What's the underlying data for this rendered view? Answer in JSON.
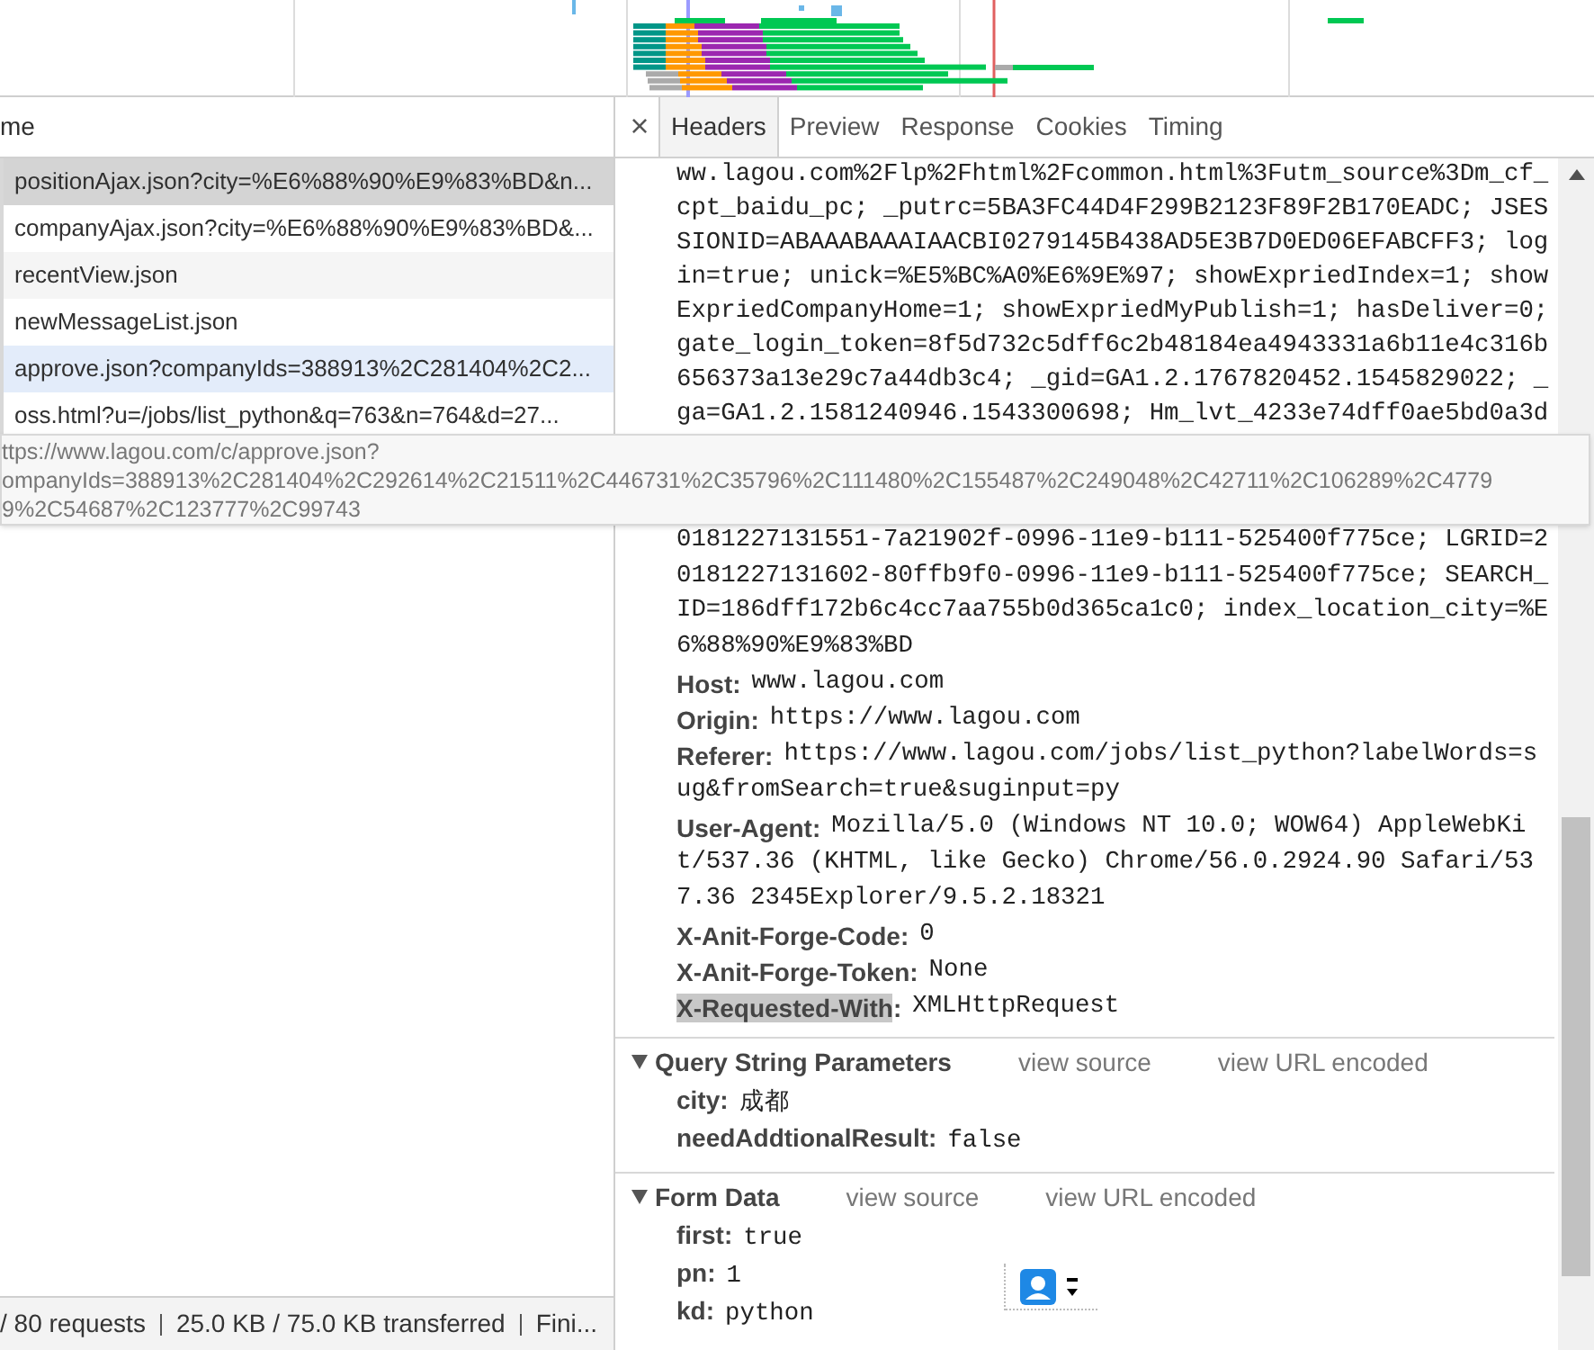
{
  "requests_panel": {
    "column_header": "me",
    "rows": [
      {
        "name": "positionAjax.json?city=%E6%88%90%E9%83%BD&n...",
        "selected": true,
        "hovered": false
      },
      {
        "name": "companyAjax.json?city=%E6%88%90%E9%83%BD&...",
        "selected": false,
        "hovered": false
      },
      {
        "name": "recentView.json",
        "selected": false,
        "hovered": false
      },
      {
        "name": "newMessageList.json",
        "selected": false,
        "hovered": false
      },
      {
        "name": "approve.json?companyIds=388913%2C281404%2C2...",
        "selected": false,
        "hovered": true
      },
      {
        "name": "oss.html?u=/jobs/list_python&q=763&n=764&d=27...",
        "selected": false,
        "hovered": false
      }
    ]
  },
  "status_bar": {
    "items": [
      "/ 80 requests",
      "25.0 KB / 75.0 KB transferred",
      "Fini..."
    ]
  },
  "tooltip": {
    "lines": [
      "ttps://www.lagou.com/c/approve.json?",
      "ompanyIds=388913%2C281404%2C292614%2C21511%2C446731%2C35796%2C111480%2C155487%2C249048%2C42711%2C106289%2C4779",
      "9%2C54687%2C123777%2C99743"
    ]
  },
  "details": {
    "close": "×",
    "tabs": [
      {
        "label": "Headers",
        "selected": true
      },
      {
        "label": "Preview",
        "selected": false
      },
      {
        "label": "Response",
        "selected": false
      },
      {
        "label": "Cookies",
        "selected": false
      },
      {
        "label": "Timing",
        "selected": false
      }
    ],
    "separator": ":",
    "cookie_lines_above": [
      "ww.lagou.com%2Flp%2Fhtml%2Fcommon.html%3Futm_source%3Dm_cf_",
      "cpt_baidu_pc; _putrc=5BA3FC44D4F299B2123F89F2B170EADC; JSES",
      "SIONID=ABAAABAAAIAACBI0279145B438AD5E3B7D0ED06EFABCFF3; log",
      "in=true; unick=%E5%BC%A0%E6%9E%97; showExpriedIndex=1; show",
      "ExpriedCompanyHome=1; showExpriedMyPublish=1; hasDeliver=0;",
      "gate_login_token=8f5d732c5dff6c2b48184ea4943331a6b11e4c316b",
      "656373a13e29c7a44db3c4; _gid=GA1.2.1767820452.1545829022; _",
      "ga=GA1.2.1581240946.1543300698; Hm_lvt_4233e74dff0ae5bd0a3d"
    ],
    "cookie_lines_below": [
      "0181227131551-7a21902f-0996-11e9-b111-525400f775ce; LGRID=2",
      "0181227131602-80ffb9f0-0996-11e9-b111-525400f775ce; SEARCH_",
      "ID=186dff172b6c4cc7aa755b0d365ca1c0; index_location_city=%E",
      "6%88%90%E9%83%BD"
    ],
    "headers": [
      {
        "name": "Host",
        "value_lines": [
          "www.lagou.com"
        ],
        "highlighted": false
      },
      {
        "name": "Origin",
        "value_lines": [
          "https://www.lagou.com"
        ],
        "highlighted": false
      },
      {
        "name": "Referer",
        "value_lines": [
          "https://www.lagou.com/jobs/list_python?labelWords=s",
          "ug&fromSearch=true&suginput=py"
        ],
        "highlighted": false
      },
      {
        "name": "User-Agent",
        "value_lines": [
          "Mozilla/5.0 (Windows NT 10.0; WOW64) AppleWebKi",
          "t/537.36 (KHTML, like Gecko) Chrome/56.0.2924.90 Safari/53",
          "7.36 2345Explorer/9.5.2.18321"
        ],
        "highlighted": false
      },
      {
        "name": "X-Anit-Forge-Code",
        "value_lines": [
          "0"
        ],
        "highlighted": false
      },
      {
        "name": "X-Anit-Forge-Token",
        "value_lines": [
          "None"
        ],
        "highlighted": false
      },
      {
        "name": "X-Requested-With",
        "value_lines": [
          "XMLHttpRequest"
        ],
        "highlighted": true
      }
    ],
    "sections": [
      {
        "title": "Query String Parameters",
        "expanded": true,
        "links": [
          "view source",
          "view URL encoded"
        ],
        "params": [
          {
            "name": "city",
            "value": "成都"
          },
          {
            "name": "needAddtionalResult",
            "value": "false"
          }
        ]
      },
      {
        "title": "Form Data",
        "expanded": true,
        "links": [
          "view source",
          "view URL encoded"
        ],
        "params": [
          {
            "name": "first",
            "value": "true"
          },
          {
            "name": "pn",
            "value": "1"
          },
          {
            "name": "kd",
            "value": "python"
          }
        ]
      }
    ]
  }
}
